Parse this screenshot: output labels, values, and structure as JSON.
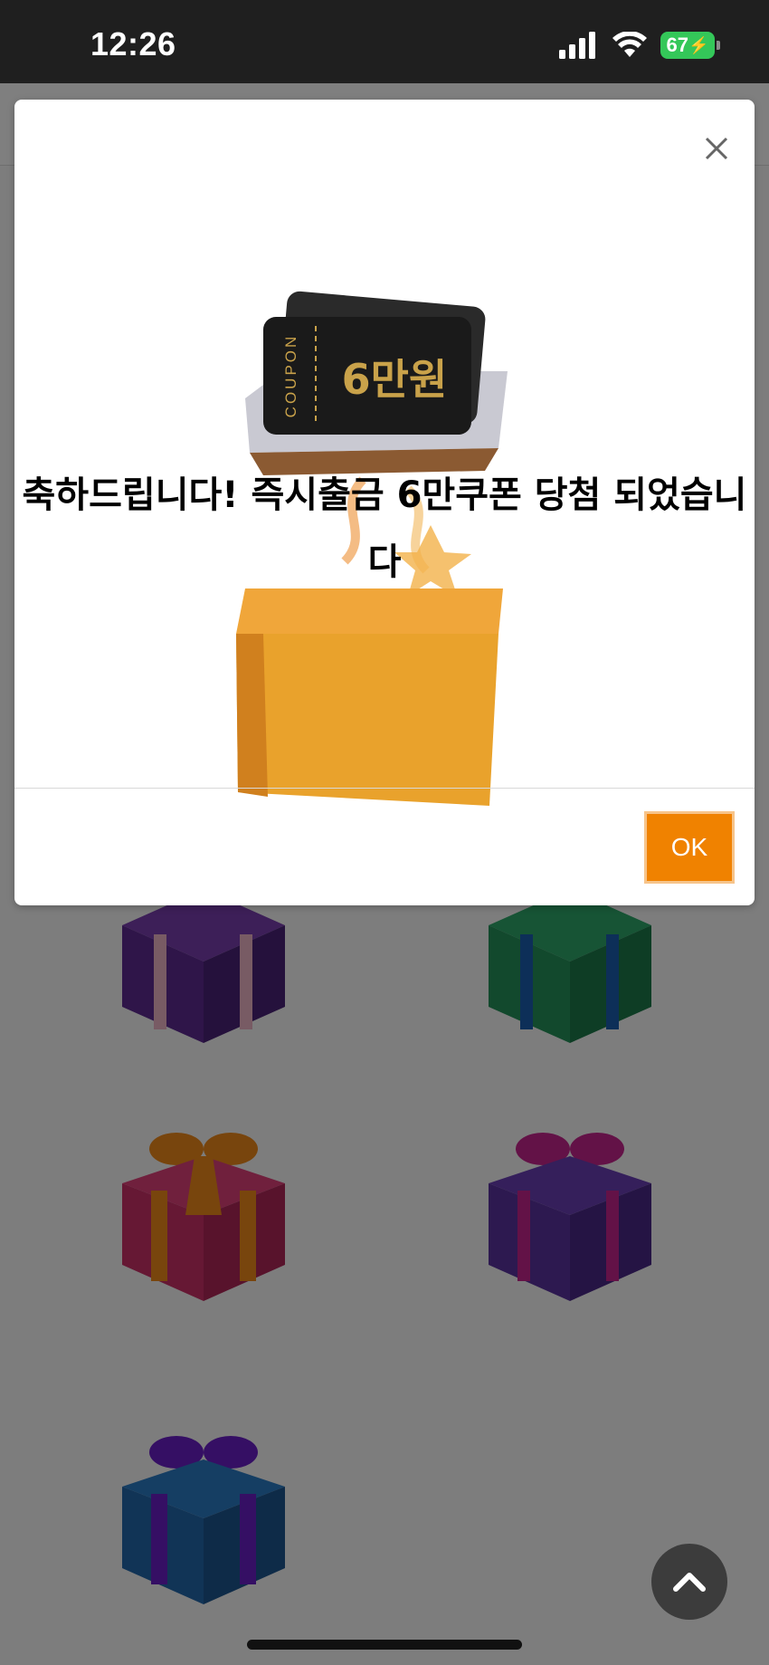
{
  "status_bar": {
    "time": "12:26",
    "battery_level": "67",
    "icons": [
      "signal-icon",
      "wifi-icon",
      "battery-charging-icon"
    ]
  },
  "background": {
    "gift_boxes": [
      {
        "color": "purple",
        "ribbon": "pink"
      },
      {
        "color": "green",
        "ribbon": "blue"
      },
      {
        "color": "pink",
        "ribbon": "orange"
      },
      {
        "color": "purple",
        "ribbon": "magenta"
      },
      {
        "color": "blue",
        "ribbon": "purple"
      }
    ],
    "scroll_top_icon": "chevron-up-icon"
  },
  "modal": {
    "coupon_amount": "6만원",
    "coupon_label": "COUPON",
    "message": "축하드립니다! 즉시출금 6만쿠폰 당첨 되었습니다",
    "ok_label": "OK",
    "close_icon": "close-icon"
  },
  "colors": {
    "accent": "#f08200",
    "coupon_gold": "#c9a24a",
    "status_bar": "#1f1f1f"
  }
}
